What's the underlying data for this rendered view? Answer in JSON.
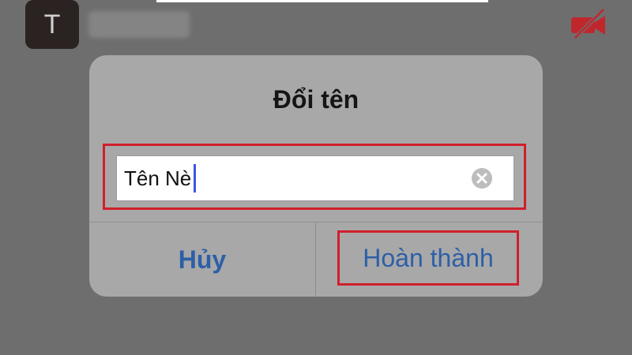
{
  "header": {
    "avatar_letter": "T",
    "video_icon": "video-off-icon",
    "video_icon_color": "#c0272d"
  },
  "dialog": {
    "title": "Đổi tên",
    "input": {
      "value": "Tên Nè",
      "clear_icon": "clear-circle-x-icon"
    },
    "buttons": {
      "cancel_label": "Hủy",
      "done_label": "Hoàn thành"
    },
    "highlight_color": "#d01f2b",
    "button_color": "#2c5fa8"
  }
}
